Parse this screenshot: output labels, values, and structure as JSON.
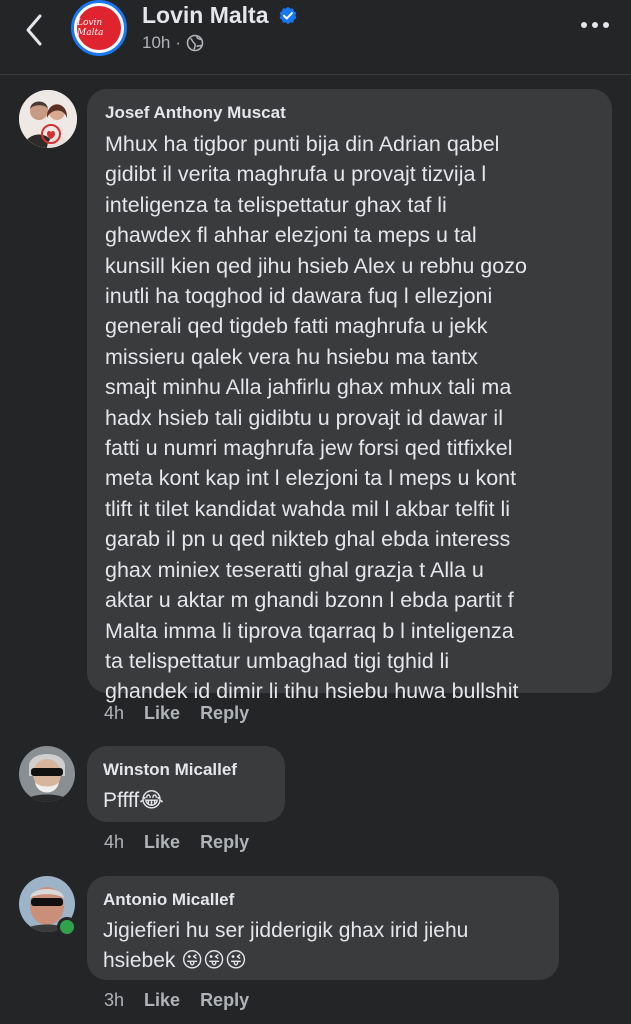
{
  "header": {
    "page_name": "Lovin Malta",
    "logo_text": "Lovin Malta",
    "time": "10h",
    "dot": "·"
  },
  "comments": [
    {
      "author": "Josef Anthony Muscat",
      "text": "Mhux ha tigbor punti bija din Adrian qabel\ngidibt il verita maghrufa u provajt tizvija l\ninteligenza ta telispettatur  ghax taf li\nghawdex fl ahhar elezjoni ta meps u tal\nkunsill kien qed jihu hsieb Alex u rebhu gozo\ninutli ha toqghod id dawara fuq l ellezjoni\ngenerali qed tigdeb fatti maghrufa u jekk\nmissieru qalek vera hu hsiebu ma tantx\nsmajt minhu Alla jahfirlu ghax mhux tali ma\nhadx hsieb tali gidibtu u provajt id dawar il\nfatti u numri maghrufa jew forsi qed titfixkel\nmeta kont kap int l elezjoni ta l meps u kont\ntlift it tilet kandidat wahda mil l akbar telfit li\ngarab il pn u qed nikteb ghal ebda interess\nghax miniex teseratti ghal grazja t Alla u\naktar u aktar m ghandi bzonn l ebda partit f\nMalta imma li tiprova tqarraq b l inteligenza\nta telispettatur umbaghad tigi tghid li\nghandek id dimir li tihu hsiebu huwa bullshit",
      "time": "4h",
      "like": "Like",
      "reply": "Reply"
    },
    {
      "author": "Winston Micallef",
      "text": "Pffff😂",
      "time": "4h",
      "like": "Like",
      "reply": "Reply"
    },
    {
      "author": "Antonio Micallef",
      "text": "Jigiefieri hu ser jidderigik ghax irid jiehu\nhsiebek 😜😜😜",
      "time": "3h",
      "like": "Like",
      "reply": "Reply"
    }
  ],
  "colors": {
    "background": "#242526",
    "bubble": "#3a3b3c",
    "text": "#e4e6eb",
    "secondary": "#b0b3b8",
    "verified": "#1877f2",
    "online": "#31a24c",
    "brand": "#e0242f"
  },
  "icons": {
    "back": "chevron-left-icon",
    "verified": "verified-badge-icon",
    "privacy": "globe-icon",
    "more": "more-horizontal-icon"
  }
}
